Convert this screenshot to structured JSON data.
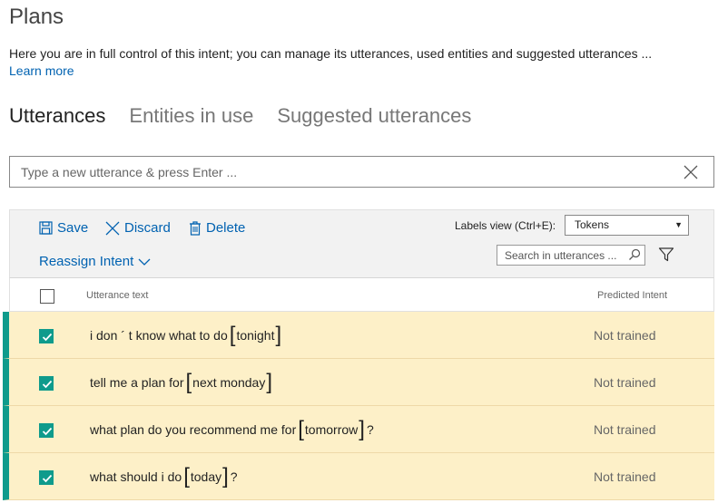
{
  "page": {
    "title": "Plans",
    "description": "Here you are in full control of this intent; you can manage its utterances, used entities and suggested utterances ...",
    "learn_more": "Learn more"
  },
  "tabs": [
    {
      "label": "Utterances",
      "active": true
    },
    {
      "label": "Entities in use",
      "active": false
    },
    {
      "label": "Suggested utterances",
      "active": false
    }
  ],
  "utterance_input": {
    "value": "",
    "placeholder": "Type a new utterance & press Enter ..."
  },
  "toolbar": {
    "save_label": "Save",
    "discard_label": "Discard",
    "delete_label": "Delete",
    "reassign_label": "Reassign Intent",
    "labels_view_label": "Labels view (Ctrl+E):",
    "labels_view_value": "Tokens",
    "search_placeholder": "Search in utterances ..."
  },
  "table": {
    "col_text": "Utterance text",
    "col_intent": "Predicted Intent",
    "rows": [
      {
        "before": "i don ´ t know what to do",
        "entity": "tonight",
        "after": "",
        "intent": "Not trained",
        "checked": true
      },
      {
        "before": "tell me a plan for",
        "entity": "next monday",
        "after": "",
        "intent": "Not trained",
        "checked": true
      },
      {
        "before": "what plan do you recommend me for",
        "entity": "tomorrow",
        "after": "?",
        "intent": "Not trained",
        "checked": true
      },
      {
        "before": "what should i do",
        "entity": "today",
        "after": "?",
        "intent": "Not trained",
        "checked": true
      }
    ]
  },
  "colors": {
    "accent": "#0062b1",
    "selected_row": "#fdf0c8",
    "selection_bar": "#0f9b8c"
  },
  "icons": [
    "save-icon",
    "discard-icon",
    "delete-icon",
    "chevron-down-icon",
    "search-icon",
    "filter-icon",
    "close-icon",
    "checkmark-icon"
  ]
}
